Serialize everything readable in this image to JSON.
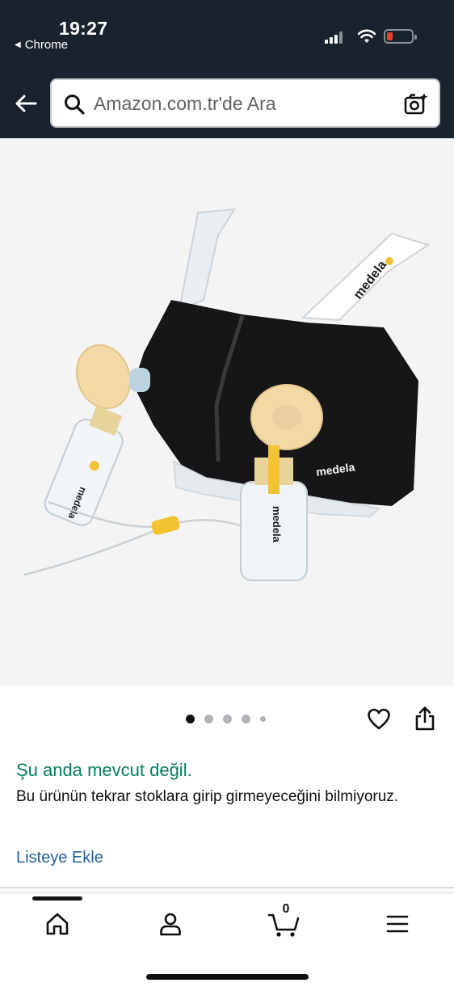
{
  "status_bar": {
    "time": "19:27",
    "back_app": "Chrome"
  },
  "search": {
    "placeholder": "Amazon.com.tr'de Ara"
  },
  "product_image": {
    "brand_label_strap": "medela",
    "brand_label_cup": "medela",
    "brand_label_bottle_left": "medela",
    "brand_label_bottle_right": "medela"
  },
  "carousel": {
    "image_count": 5,
    "active_index": 0
  },
  "availability": {
    "status": "Şu anda mevcut değil.",
    "detail": "Bu ürünün tekrar stoklara girip girmeyeceğini bilmiyoruz."
  },
  "actions": {
    "add_to_list": "Listeye Ekle"
  },
  "bottom_nav": {
    "cart_count": "0"
  },
  "colors": {
    "header_bg": "#1a222d",
    "availability_text": "#067d62",
    "link_text": "#2162a1"
  }
}
